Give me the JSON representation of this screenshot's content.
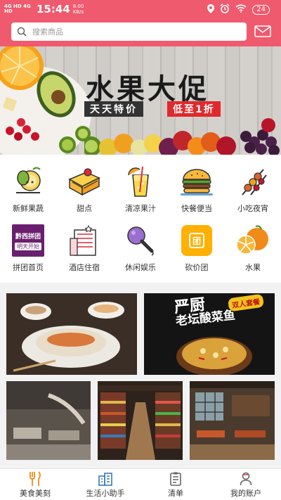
{
  "status_bar": {
    "network": "4G HD 4G HD",
    "time": "15:44",
    "speed_value": "8.00",
    "speed_unit": "KB/s",
    "battery": "24"
  },
  "search": {
    "placeholder": "搜索商品"
  },
  "banner": {
    "title": "水果大促",
    "tag_left": "天天特价",
    "tag_right": "低至1折"
  },
  "categories": [
    {
      "label": "新鲜果蔬",
      "icon": "fruit-veg-icon"
    },
    {
      "label": "甜点",
      "icon": "cake-icon"
    },
    {
      "label": "清凉果汁",
      "icon": "juice-icon"
    },
    {
      "label": "快餐便当",
      "icon": "burger-icon"
    },
    {
      "label": "小吃夜宵",
      "icon": "skewer-icon"
    },
    {
      "label": "拼团首页",
      "icon": "group-buy-icon"
    },
    {
      "label": "酒店住宿",
      "icon": "hotel-icon"
    },
    {
      "label": "休闲娱乐",
      "icon": "microphone-icon"
    },
    {
      "label": "砍价团",
      "icon": "bargain-icon"
    },
    {
      "label": "水果",
      "icon": "orange-icon"
    }
  ],
  "group_icon": {
    "line1": "黔西拼团",
    "line2": "明天开始"
  },
  "bargain_icon": {
    "char": "团"
  },
  "promos": {
    "fish_title_1": "严厨",
    "fish_title_2": "老坛酸菜鱼",
    "fish_badge": "双人套餐"
  },
  "tabs": [
    {
      "label": "美食美刻",
      "icon": "fork-knife-icon"
    },
    {
      "label": "生活小助手",
      "icon": "building-icon"
    },
    {
      "label": "清单",
      "icon": "list-icon"
    },
    {
      "label": "我的账户",
      "icon": "user-icon"
    }
  ],
  "colors": {
    "brand": "#f05a6e",
    "accent": "#ffb000"
  }
}
